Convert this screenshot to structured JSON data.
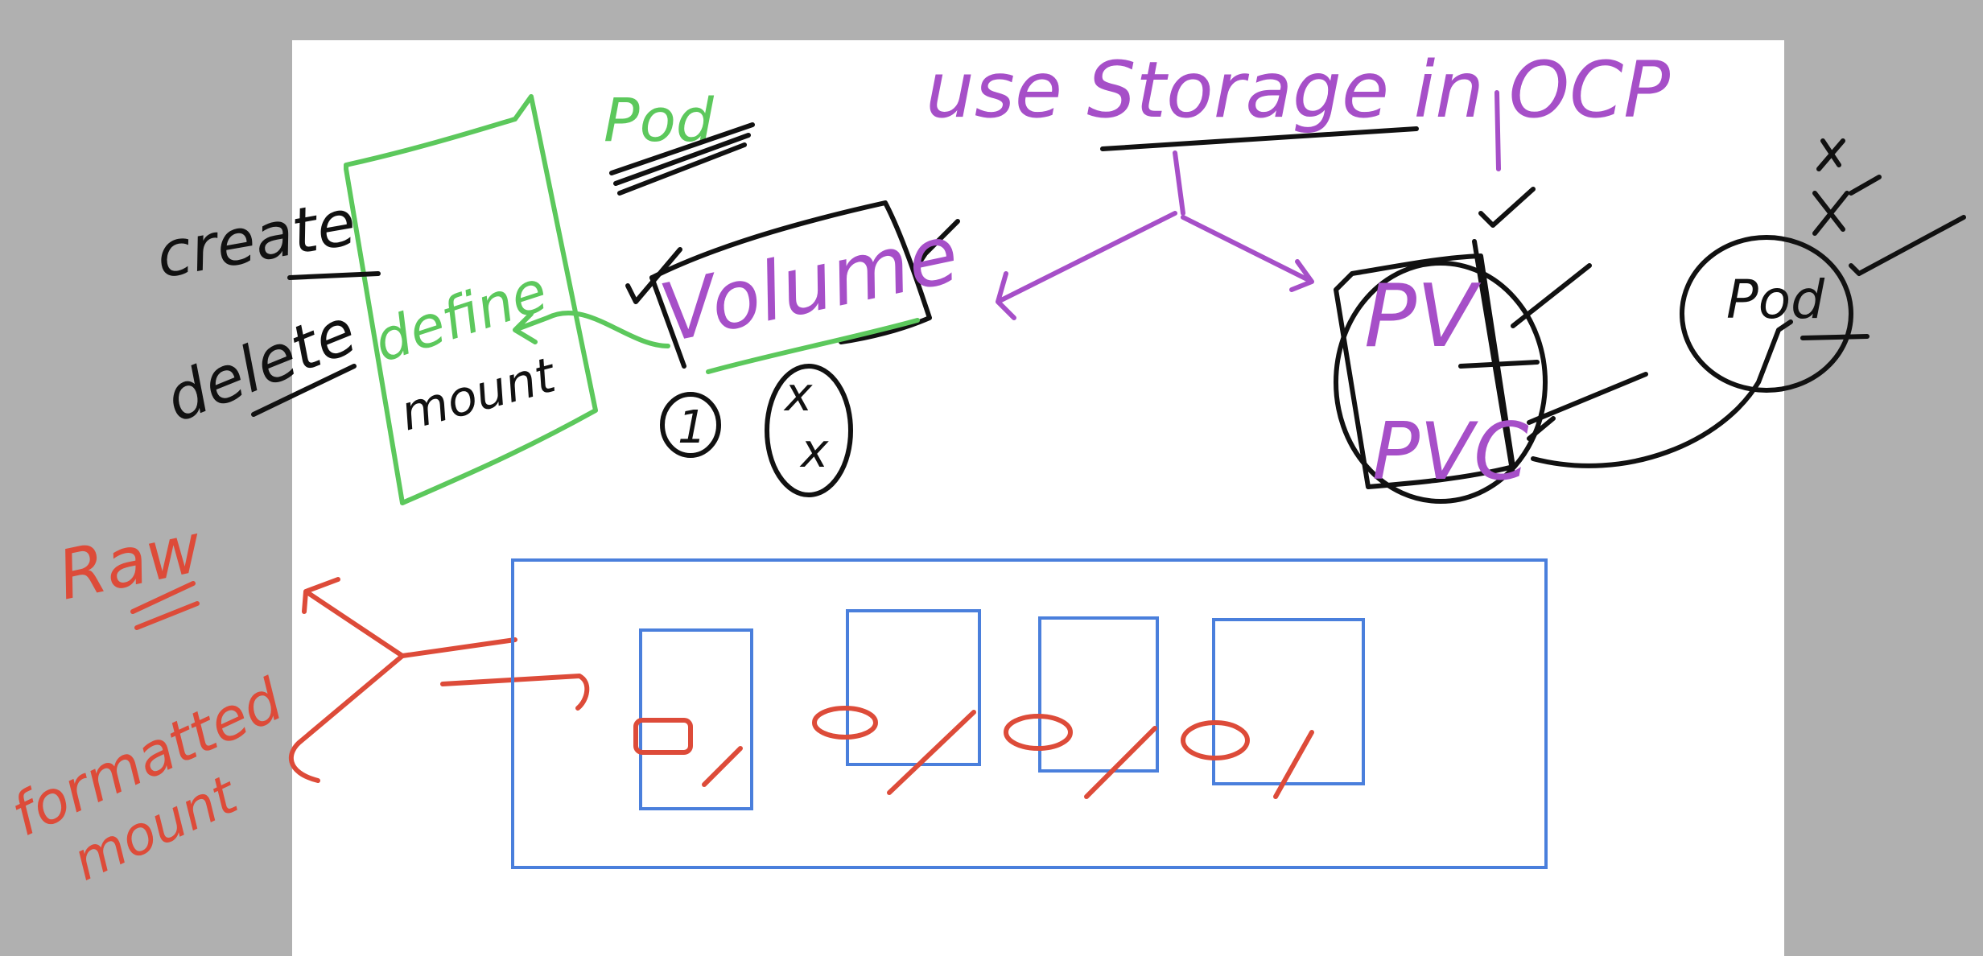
{
  "colors": {
    "backdrop": "#b0b0b0",
    "page": "#ffffff",
    "black": "#111111",
    "green": "#5cc85c",
    "purple": "#a64fc8",
    "red": "#dd4b39",
    "blue": "#4a7fdc"
  },
  "notes": {
    "title": "use Storage in OCP",
    "pod_top": "Pod",
    "create": "create",
    "delete": "delete",
    "define": "define",
    "mount": "mount",
    "volume": "Volume",
    "pv": "PV",
    "pvc": "PVC",
    "pod_right": "Pod",
    "raw": "Raw",
    "formatted": "formatted",
    "mount_red": "mount",
    "circle_one": "1",
    "x_mark": "x"
  }
}
